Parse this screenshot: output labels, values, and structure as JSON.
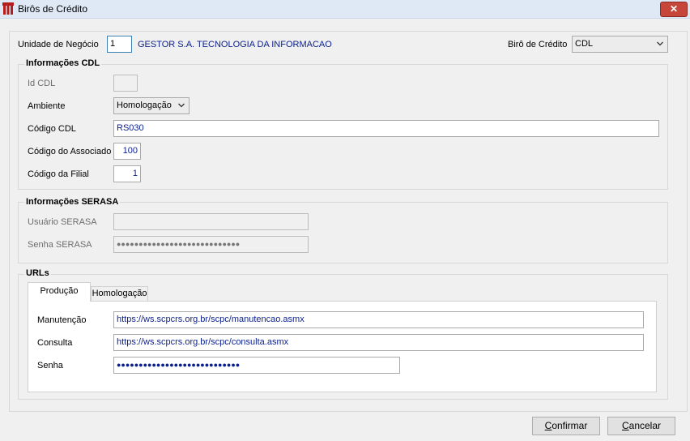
{
  "window": {
    "title": "Birôs de Crédito",
    "close": "✕"
  },
  "header": {
    "unidade_label": "Unidade de Negócio",
    "unidade_value": "1",
    "unidade_name": "GESTOR S.A. TECNOLOGIA DA INFORMACAO",
    "biro_label": "Birô de Crédito",
    "biro_value": "CDL"
  },
  "cdl": {
    "title": "Informações CDL",
    "id_label": "Id CDL",
    "id_value": "",
    "ambiente_label": "Ambiente",
    "ambiente_value": "Homologação",
    "codigo_label": "Código CDL",
    "codigo_value": "RS030",
    "associado_label": "Código do Associado",
    "associado_value": "100",
    "filial_label": "Código da Filial",
    "filial_value": "1"
  },
  "serasa": {
    "title": "Informações SERASA",
    "usuario_label": "Usuário SERASA",
    "usuario_value": "",
    "senha_label": "Senha SERASA",
    "senha_value": "●●●●●●●●●●●●●●●●●●●●●●●●●●●●"
  },
  "urls": {
    "title": "URLs",
    "tabs": [
      "Produção",
      "Homologação"
    ],
    "manutencao_label": "Manutenção",
    "manutencao_value": "https://ws.scpcrs.org.br/scpc/manutencao.asmx",
    "consulta_label": "Consulta",
    "consulta_value": "https://ws.scpcrs.org.br/scpc/consulta.asmx",
    "senha_label": "Senha",
    "senha_value": "●●●●●●●●●●●●●●●●●●●●●●●●●●●●"
  },
  "buttons": {
    "confirm_prefix": "C",
    "confirm_rest": "onfirmar",
    "cancel_prefix": "C",
    "cancel_rest": "ancelar"
  },
  "colors": {
    "accent_text": "#0a1e8c",
    "close": "#c7463a"
  }
}
